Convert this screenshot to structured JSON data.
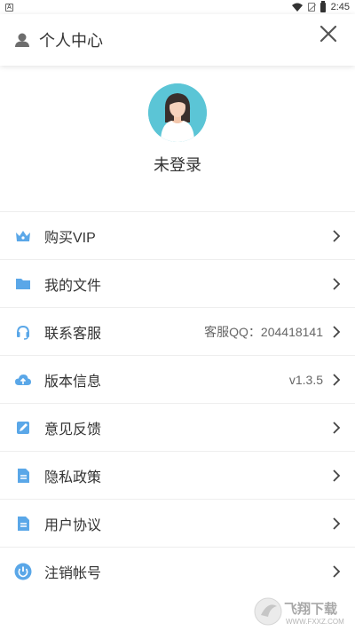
{
  "statusbar": {
    "time": "2:45",
    "left_indicator": "A"
  },
  "header": {
    "title": "个人中心",
    "icon": "person-icon",
    "close_icon": "close-icon"
  },
  "profile": {
    "status": "未登录"
  },
  "menu": {
    "items": [
      {
        "label": "购买VIP",
        "value": "",
        "icon": "crown-icon"
      },
      {
        "label": "我的文件",
        "value": "",
        "icon": "folder-icon"
      },
      {
        "label": "联系客服",
        "value": "客服QQ：204418141",
        "icon": "headset-icon"
      },
      {
        "label": "版本信息",
        "value": "v1.3.5",
        "icon": "cloud-upload-icon"
      },
      {
        "label": "意见反馈",
        "value": "",
        "icon": "edit-icon"
      },
      {
        "label": "隐私政策",
        "value": "",
        "icon": "document-icon"
      },
      {
        "label": "用户协议",
        "value": "",
        "icon": "document-icon"
      },
      {
        "label": "注销帐号",
        "value": "",
        "icon": "power-icon"
      }
    ]
  },
  "watermark": {
    "text": "飞翔下载",
    "sub": "WWW.FXXZ.COM"
  },
  "colors": {
    "accent": "#5aa7e8",
    "avatar_bg": "#5bc5d6"
  }
}
